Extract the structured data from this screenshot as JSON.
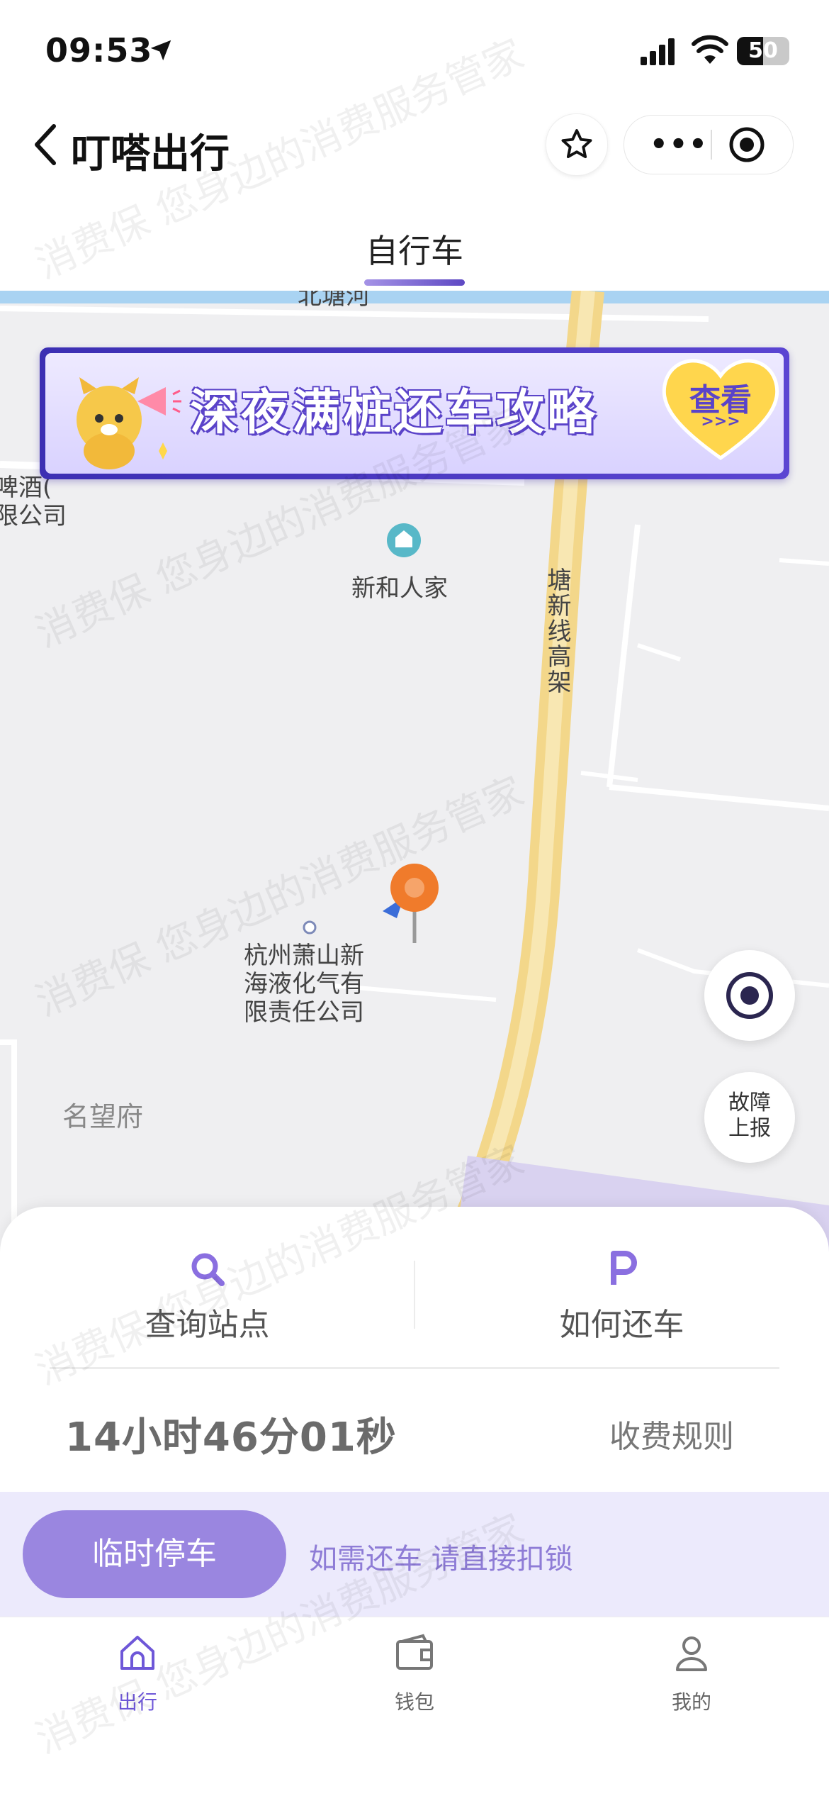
{
  "status": {
    "time": "09:53",
    "battery": "50"
  },
  "header": {
    "title": "叮嗒出行",
    "tab": "自行车"
  },
  "banner": {
    "text": "深夜满桩还车攻略",
    "cta": "查看",
    "cta_sub": ">>>"
  },
  "map": {
    "labels": {
      "river": "北塘河",
      "company_left_1": "啤酒(",
      "company_left_2": "限公司",
      "poi": "新和人家",
      "road": "塘新线高架",
      "company_1": "杭州萧山新",
      "company_2": "海液化气有",
      "company_3": "限责任公司",
      "estate": "名望府",
      "road_partial": "塘"
    },
    "report_button": {
      "line1": "故障",
      "line2": "上报"
    }
  },
  "sheet": {
    "query_stations": "查询站点",
    "return_bike": "如何还车",
    "timer": "14小时46分01秒",
    "fee_rules": "收费规则",
    "park_button": "临时停车",
    "park_hint": "如需还车 请直接扣锁"
  },
  "bottom_nav": [
    {
      "label": "出行",
      "icon": "home-icon"
    },
    {
      "label": "钱包",
      "icon": "wallet-icon"
    },
    {
      "label": "我的",
      "icon": "user-icon"
    }
  ],
  "watermark": "消费保 您身边的消费服务管家",
  "colors": {
    "accent": "#6e57d8",
    "accent_light": "#9a86e0",
    "road": "#f5dc90"
  }
}
